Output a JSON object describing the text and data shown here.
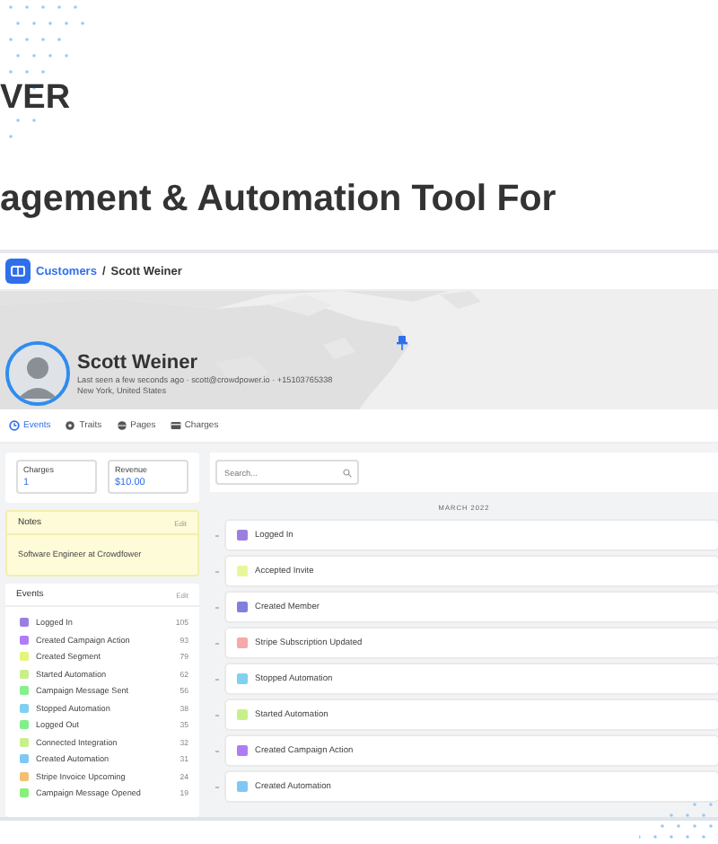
{
  "brand": {
    "text": "VER"
  },
  "headline": "agement & Automation Tool For",
  "breadcrumb": {
    "link": "Customers",
    "separator": "/",
    "current": "Scott Weiner"
  },
  "profile": {
    "name": "Scott Weiner",
    "details": "Last seen a few seconds ago · scott@crowdpower.io · +15103765338",
    "location": "New York, United States"
  },
  "tabs": [
    {
      "label": "Events",
      "selected": true,
      "kind": "events"
    },
    {
      "label": "Traits",
      "selected": false,
      "kind": "traits"
    },
    {
      "label": "Pages",
      "selected": false,
      "kind": "pages"
    },
    {
      "label": "Charges",
      "selected": false,
      "kind": "charges"
    }
  ],
  "stats": [
    {
      "label": "Charges",
      "value": "1"
    },
    {
      "label": "Revenue",
      "value": "$10.00"
    }
  ],
  "notes": {
    "title": "Notes",
    "action": "Edit",
    "text": "Software Engineer at Crowdfower"
  },
  "events_panel": {
    "title": "Events",
    "action": "Edit",
    "items": [
      {
        "name": "Logged In",
        "count": "105",
        "color": "#9b7fe0"
      },
      {
        "name": "Created Campaign Action",
        "count": "93",
        "color": "#b07cf5"
      },
      {
        "name": "Created Segment",
        "count": "79",
        "color": "#e4f57a"
      },
      {
        "name": "Started Automation",
        "count": "62",
        "color": "#c8f08a"
      },
      {
        "name": "Campaign Message Sent",
        "count": "56",
        "color": "#86f08a"
      },
      {
        "name": "Stopped Automation",
        "count": "38",
        "color": "#7fd0f0"
      },
      {
        "name": "Logged Out",
        "count": "35",
        "color": "#7ff08a"
      },
      {
        "name": "Connected Integration",
        "count": "32",
        "color": "#c8f08a"
      },
      {
        "name": "Created Automation",
        "count": "31",
        "color": "#7fc8f5"
      },
      {
        "name": "Stripe Invoice Upcoming",
        "count": "24",
        "color": "#f2c070"
      },
      {
        "name": "Campaign Message Opened",
        "count": "19",
        "color": "#86f07a"
      }
    ]
  },
  "search": {
    "placeholder": "Search..."
  },
  "timeline": {
    "month": "MARCH 2022",
    "items": [
      {
        "name": "Logged In",
        "color": "#9b7fe0"
      },
      {
        "name": "Accepted Invite",
        "color": "#e8f79a"
      },
      {
        "name": "Created Member",
        "color": "#7f7fe0"
      },
      {
        "name": "Stripe Subscription Updated",
        "color": "#f7a8a8"
      },
      {
        "name": "Stopped Automation",
        "color": "#80d0f0"
      },
      {
        "name": "Started Automation",
        "color": "#c8f08a"
      },
      {
        "name": "Created Campaign Action",
        "color": "#b07cf5"
      },
      {
        "name": "Created Automation",
        "color": "#7fc8f5"
      }
    ]
  }
}
